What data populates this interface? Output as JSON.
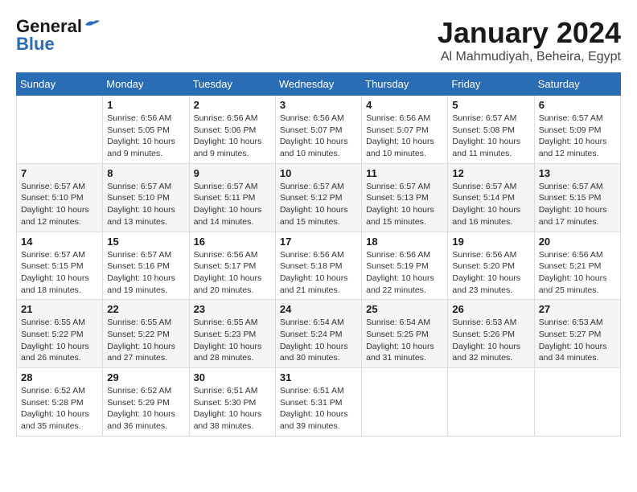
{
  "header": {
    "logo_general": "General",
    "logo_blue": "Blue",
    "month_title": "January 2024",
    "location": "Al Mahmudiyah, Beheira, Egypt"
  },
  "weekdays": [
    "Sunday",
    "Monday",
    "Tuesday",
    "Wednesday",
    "Thursday",
    "Friday",
    "Saturday"
  ],
  "weeks": [
    [
      {
        "day": "",
        "info": ""
      },
      {
        "day": "1",
        "info": "Sunrise: 6:56 AM\nSunset: 5:05 PM\nDaylight: 10 hours\nand 9 minutes."
      },
      {
        "day": "2",
        "info": "Sunrise: 6:56 AM\nSunset: 5:06 PM\nDaylight: 10 hours\nand 9 minutes."
      },
      {
        "day": "3",
        "info": "Sunrise: 6:56 AM\nSunset: 5:07 PM\nDaylight: 10 hours\nand 10 minutes."
      },
      {
        "day": "4",
        "info": "Sunrise: 6:56 AM\nSunset: 5:07 PM\nDaylight: 10 hours\nand 10 minutes."
      },
      {
        "day": "5",
        "info": "Sunrise: 6:57 AM\nSunset: 5:08 PM\nDaylight: 10 hours\nand 11 minutes."
      },
      {
        "day": "6",
        "info": "Sunrise: 6:57 AM\nSunset: 5:09 PM\nDaylight: 10 hours\nand 12 minutes."
      }
    ],
    [
      {
        "day": "7",
        "info": "Sunrise: 6:57 AM\nSunset: 5:10 PM\nDaylight: 10 hours\nand 12 minutes."
      },
      {
        "day": "8",
        "info": "Sunrise: 6:57 AM\nSunset: 5:10 PM\nDaylight: 10 hours\nand 13 minutes."
      },
      {
        "day": "9",
        "info": "Sunrise: 6:57 AM\nSunset: 5:11 PM\nDaylight: 10 hours\nand 14 minutes."
      },
      {
        "day": "10",
        "info": "Sunrise: 6:57 AM\nSunset: 5:12 PM\nDaylight: 10 hours\nand 15 minutes."
      },
      {
        "day": "11",
        "info": "Sunrise: 6:57 AM\nSunset: 5:13 PM\nDaylight: 10 hours\nand 15 minutes."
      },
      {
        "day": "12",
        "info": "Sunrise: 6:57 AM\nSunset: 5:14 PM\nDaylight: 10 hours\nand 16 minutes."
      },
      {
        "day": "13",
        "info": "Sunrise: 6:57 AM\nSunset: 5:15 PM\nDaylight: 10 hours\nand 17 minutes."
      }
    ],
    [
      {
        "day": "14",
        "info": "Sunrise: 6:57 AM\nSunset: 5:15 PM\nDaylight: 10 hours\nand 18 minutes."
      },
      {
        "day": "15",
        "info": "Sunrise: 6:57 AM\nSunset: 5:16 PM\nDaylight: 10 hours\nand 19 minutes."
      },
      {
        "day": "16",
        "info": "Sunrise: 6:56 AM\nSunset: 5:17 PM\nDaylight: 10 hours\nand 20 minutes."
      },
      {
        "day": "17",
        "info": "Sunrise: 6:56 AM\nSunset: 5:18 PM\nDaylight: 10 hours\nand 21 minutes."
      },
      {
        "day": "18",
        "info": "Sunrise: 6:56 AM\nSunset: 5:19 PM\nDaylight: 10 hours\nand 22 minutes."
      },
      {
        "day": "19",
        "info": "Sunrise: 6:56 AM\nSunset: 5:20 PM\nDaylight: 10 hours\nand 23 minutes."
      },
      {
        "day": "20",
        "info": "Sunrise: 6:56 AM\nSunset: 5:21 PM\nDaylight: 10 hours\nand 25 minutes."
      }
    ],
    [
      {
        "day": "21",
        "info": "Sunrise: 6:55 AM\nSunset: 5:22 PM\nDaylight: 10 hours\nand 26 minutes."
      },
      {
        "day": "22",
        "info": "Sunrise: 6:55 AM\nSunset: 5:22 PM\nDaylight: 10 hours\nand 27 minutes."
      },
      {
        "day": "23",
        "info": "Sunrise: 6:55 AM\nSunset: 5:23 PM\nDaylight: 10 hours\nand 28 minutes."
      },
      {
        "day": "24",
        "info": "Sunrise: 6:54 AM\nSunset: 5:24 PM\nDaylight: 10 hours\nand 30 minutes."
      },
      {
        "day": "25",
        "info": "Sunrise: 6:54 AM\nSunset: 5:25 PM\nDaylight: 10 hours\nand 31 minutes."
      },
      {
        "day": "26",
        "info": "Sunrise: 6:53 AM\nSunset: 5:26 PM\nDaylight: 10 hours\nand 32 minutes."
      },
      {
        "day": "27",
        "info": "Sunrise: 6:53 AM\nSunset: 5:27 PM\nDaylight: 10 hours\nand 34 minutes."
      }
    ],
    [
      {
        "day": "28",
        "info": "Sunrise: 6:52 AM\nSunset: 5:28 PM\nDaylight: 10 hours\nand 35 minutes."
      },
      {
        "day": "29",
        "info": "Sunrise: 6:52 AM\nSunset: 5:29 PM\nDaylight: 10 hours\nand 36 minutes."
      },
      {
        "day": "30",
        "info": "Sunrise: 6:51 AM\nSunset: 5:30 PM\nDaylight: 10 hours\nand 38 minutes."
      },
      {
        "day": "31",
        "info": "Sunrise: 6:51 AM\nSunset: 5:31 PM\nDaylight: 10 hours\nand 39 minutes."
      },
      {
        "day": "",
        "info": ""
      },
      {
        "day": "",
        "info": ""
      },
      {
        "day": "",
        "info": ""
      }
    ]
  ]
}
